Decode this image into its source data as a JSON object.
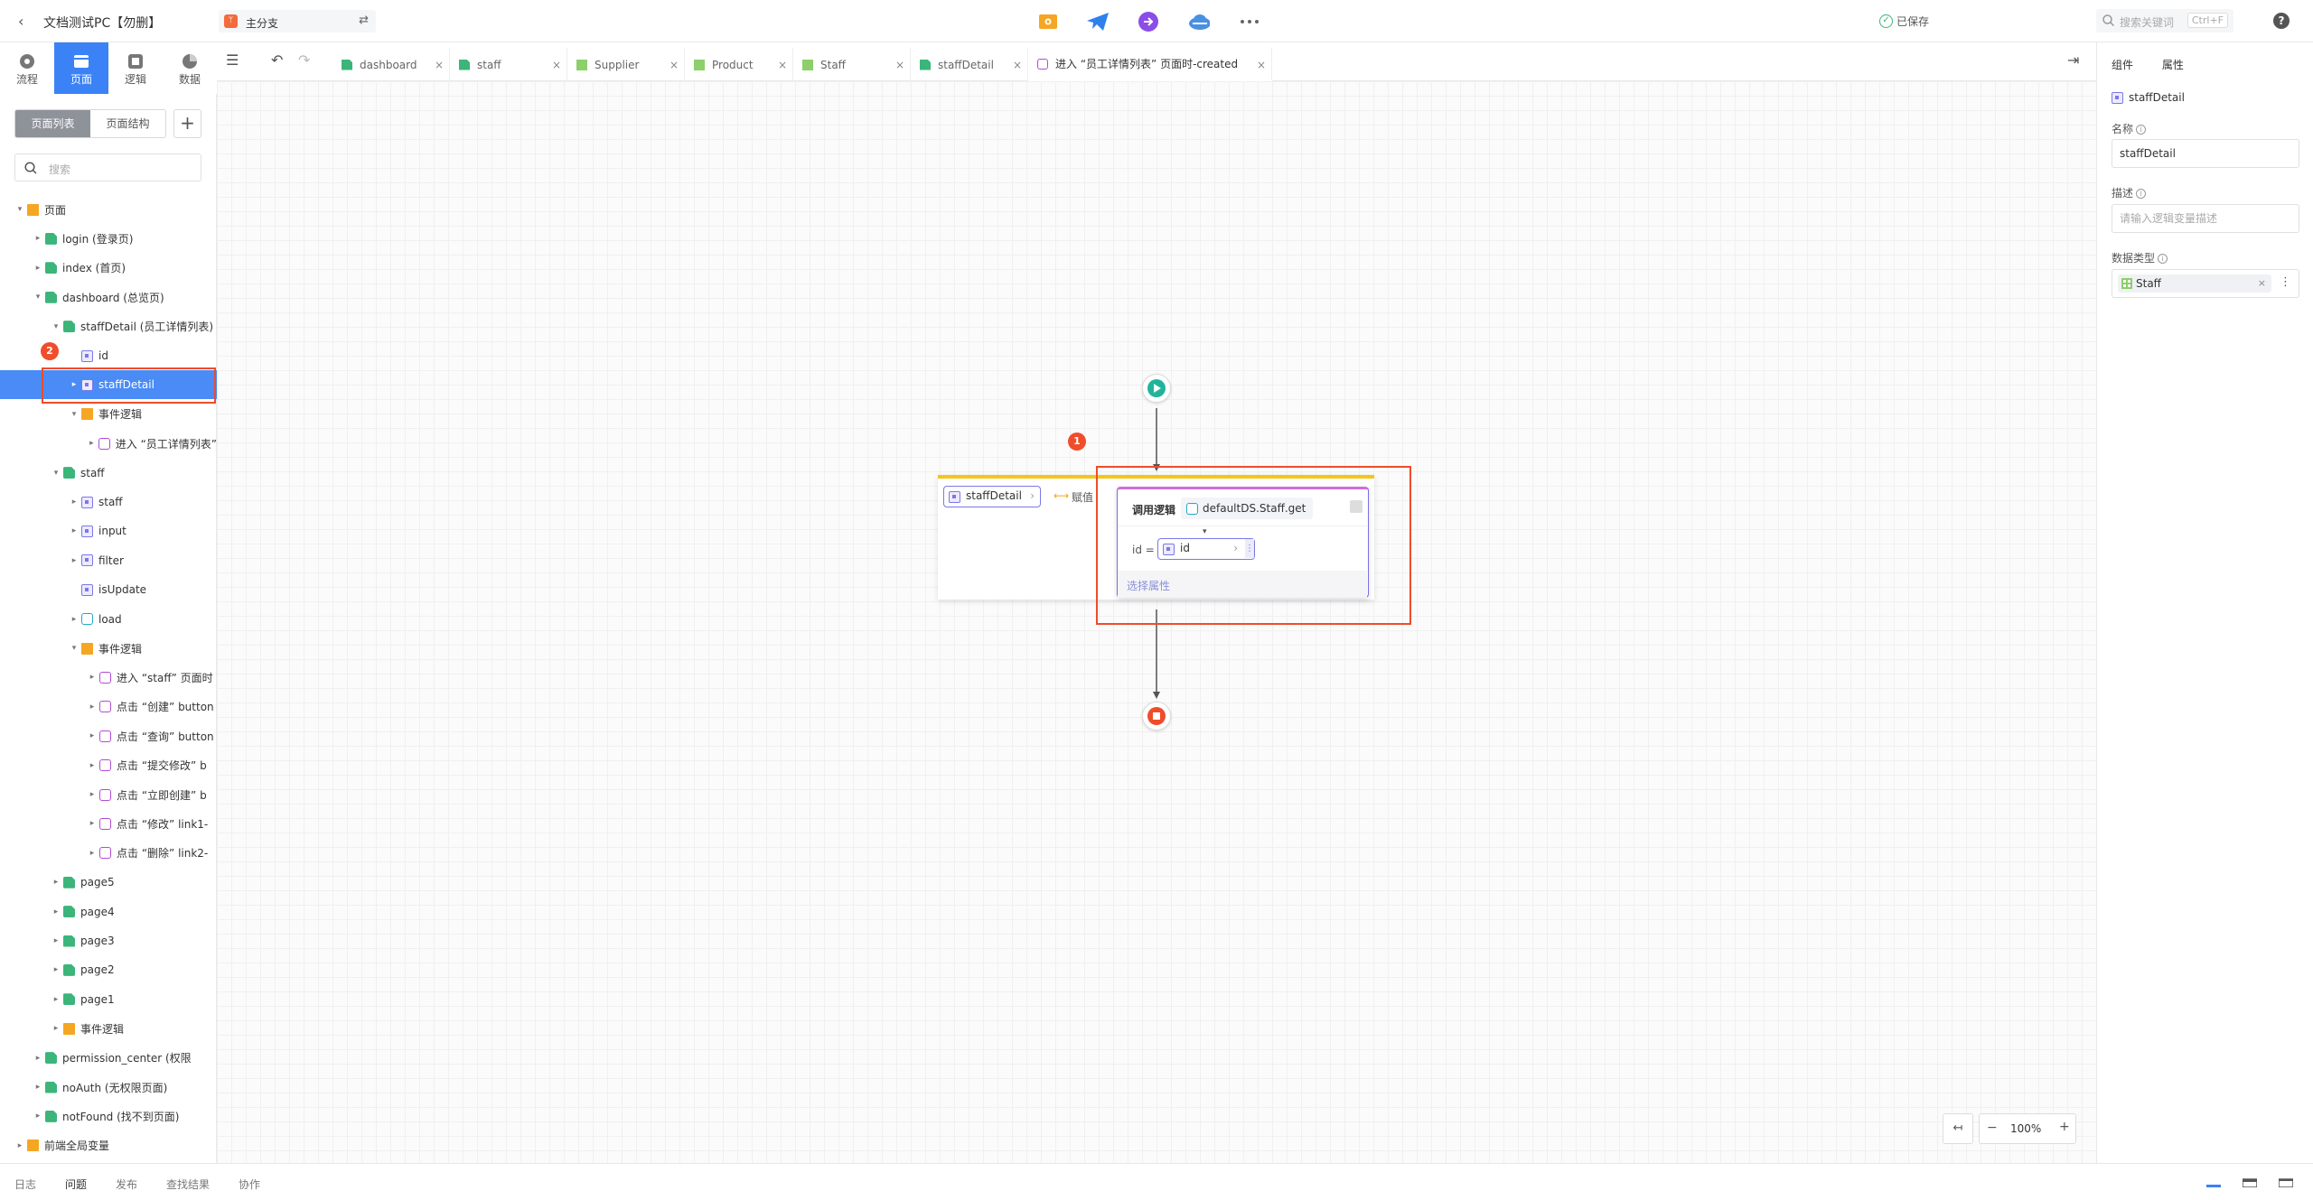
{
  "app": {
    "title": "文档测试PC【勿删】",
    "branch": "主分支",
    "saved": "已保存",
    "search_placeholder": "搜索关键词",
    "search_shortcut": "Ctrl+F",
    "help": "?"
  },
  "nav": [
    {
      "label": "流程"
    },
    {
      "label": "页面"
    },
    {
      "label": "逻辑"
    },
    {
      "label": "数据"
    }
  ],
  "sidebar": {
    "seg_pages": "页面列表",
    "seg_structure": "页面结构",
    "add": "+",
    "search_placeholder": "搜索",
    "tree": [
      {
        "label": "页面",
        "icon": "folder",
        "depth": 0,
        "arrow": "▾"
      },
      {
        "label": "login (登录页)",
        "icon": "page",
        "depth": 1,
        "arrow": "▸"
      },
      {
        "label": "index (首页)",
        "icon": "page",
        "depth": 1,
        "arrow": "▸"
      },
      {
        "label": "dashboard (总览页)",
        "icon": "page",
        "depth": 1,
        "arrow": "▾"
      },
      {
        "label": "staffDetail (员工详情列表)",
        "icon": "page",
        "depth": 2,
        "arrow": "▾"
      },
      {
        "label": "id",
        "icon": "var",
        "depth": 3,
        "arrow": ""
      },
      {
        "label": "staffDetail",
        "icon": "var",
        "depth": 3,
        "arrow": "▸",
        "selected": true
      },
      {
        "label": "事件逻辑",
        "icon": "folder",
        "depth": 3,
        "arrow": "▾"
      },
      {
        "label": "进入 “员工详情列表”",
        "icon": "logic",
        "depth": 4,
        "arrow": "▸"
      },
      {
        "label": "staff",
        "icon": "page",
        "depth": 2,
        "arrow": "▾"
      },
      {
        "label": "staff",
        "icon": "var",
        "depth": 3,
        "arrow": "▸"
      },
      {
        "label": "input",
        "icon": "var",
        "depth": 3,
        "arrow": "▸"
      },
      {
        "label": "filter",
        "icon": "var",
        "depth": 3,
        "arrow": "▸"
      },
      {
        "label": "isUpdate",
        "icon": "var",
        "depth": 3,
        "arrow": ""
      },
      {
        "label": "load",
        "icon": "load",
        "depth": 3,
        "arrow": "▸"
      },
      {
        "label": "事件逻辑",
        "icon": "folder",
        "depth": 3,
        "arrow": "▾"
      },
      {
        "label": "进入 “staff” 页面时",
        "icon": "logic",
        "depth": 4,
        "arrow": "▸"
      },
      {
        "label": "点击 “创建” button",
        "icon": "logic",
        "depth": 4,
        "arrow": "▸"
      },
      {
        "label": "点击 “查询” button",
        "icon": "logic",
        "depth": 4,
        "arrow": "▸"
      },
      {
        "label": "点击 “提交修改” b",
        "icon": "logic",
        "depth": 4,
        "arrow": "▸"
      },
      {
        "label": "点击 “立即创建” b",
        "icon": "logic",
        "depth": 4,
        "arrow": "▸"
      },
      {
        "label": "点击 “修改” link1-",
        "icon": "logic",
        "depth": 4,
        "arrow": "▸"
      },
      {
        "label": "点击 “删除” link2-",
        "icon": "logic",
        "depth": 4,
        "arrow": "▸"
      },
      {
        "label": "page5",
        "icon": "page",
        "depth": 2,
        "arrow": "▸"
      },
      {
        "label": "page4",
        "icon": "page",
        "depth": 2,
        "arrow": "▸"
      },
      {
        "label": "page3",
        "icon": "page",
        "depth": 2,
        "arrow": "▸"
      },
      {
        "label": "page2",
        "icon": "page",
        "depth": 2,
        "arrow": "▸"
      },
      {
        "label": "page1",
        "icon": "page",
        "depth": 2,
        "arrow": "▸"
      },
      {
        "label": "事件逻辑",
        "icon": "folder",
        "depth": 2,
        "arrow": "▸"
      },
      {
        "label": "permission_center (权限",
        "icon": "page",
        "depth": 1,
        "arrow": "▸"
      },
      {
        "label": "noAuth (无权限页面)",
        "icon": "page",
        "depth": 1,
        "arrow": "▸"
      },
      {
        "label": "notFound (找不到页面)",
        "icon": "page",
        "depth": 1,
        "arrow": "▸"
      },
      {
        "label": "前端全局变量",
        "icon": "folder",
        "depth": 0,
        "arrow": "▸"
      }
    ],
    "badge": "2"
  },
  "tabs": [
    {
      "label": "dashboard",
      "icon": "page"
    },
    {
      "label": "staff",
      "icon": "page"
    },
    {
      "label": "Supplier",
      "icon": "entity"
    },
    {
      "label": "Product",
      "icon": "entity"
    },
    {
      "label": "Staff",
      "icon": "entity"
    },
    {
      "label": "staffDetail",
      "icon": "page"
    },
    {
      "label": "进入 “员工详情列表” 页面时-created",
      "icon": "logic",
      "active": true
    }
  ],
  "flow": {
    "badge": "1",
    "assign_var": "staffDetail",
    "assign_label": "赋值",
    "call_label": "调用逻辑",
    "call_target": "defaultDS.Staff.get",
    "param_name": "id =",
    "param_value": "id",
    "select_attr": "选择属性"
  },
  "zoom": {
    "minus": "−",
    "value": "100%",
    "plus": "+",
    "fit": "↤"
  },
  "right": {
    "tab_component": "组件",
    "tab_props": "属性",
    "var_name": "staffDetail",
    "name_label": "名称",
    "name_value": "staffDetail",
    "desc_label": "描述",
    "desc_placeholder": "请输入逻辑变量描述",
    "type_label": "数据类型",
    "type_value": "Staff"
  },
  "bottom": [
    {
      "label": "日志"
    },
    {
      "label": "问题"
    },
    {
      "label": "发布"
    },
    {
      "label": "查找结果"
    },
    {
      "label": "协作"
    }
  ],
  "colors": {
    "accent": "#3b82f6",
    "highlight": "#ef4c2a",
    "page_green": "#3bb57a",
    "logic_purple": "#b04ad8"
  }
}
